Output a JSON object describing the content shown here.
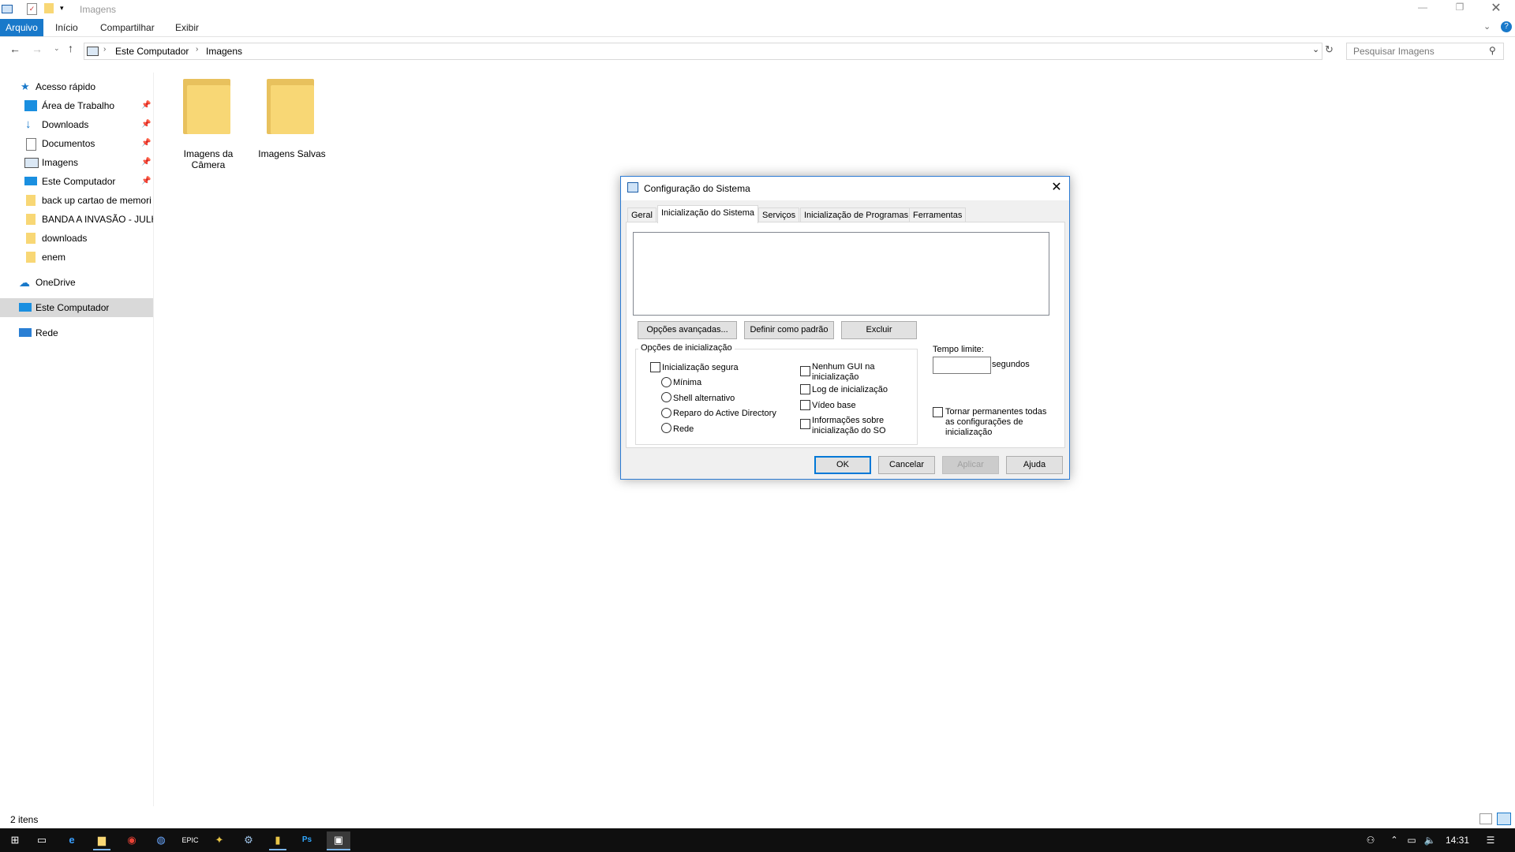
{
  "window": {
    "title": "Imagens",
    "ribbon_tabs": [
      "Arquivo",
      "Início",
      "Compartilhar",
      "Exibir"
    ]
  },
  "address": {
    "path": [
      "Este Computador",
      "Imagens"
    ],
    "search_placeholder": "Pesquisar Imagens"
  },
  "nav": {
    "quick_access": "Acesso rápido",
    "items": [
      {
        "label": "Área de Trabalho",
        "icon": "desktop-icon",
        "pinned": true
      },
      {
        "label": "Downloads",
        "icon": "download-arrow-icon",
        "pinned": true
      },
      {
        "label": "Documentos",
        "icon": "document-icon",
        "pinned": true
      },
      {
        "label": "Imagens",
        "icon": "pictures-icon",
        "pinned": true
      },
      {
        "label": "Este Computador",
        "icon": "computer-icon",
        "pinned": true
      },
      {
        "label": "back up cartao de memori",
        "icon": "folder-icon",
        "pinned": false
      },
      {
        "label": "BANDA A INVASÃO - JULH",
        "icon": "folder-icon",
        "pinned": false
      },
      {
        "label": "downloads",
        "icon": "folder-icon",
        "pinned": false
      },
      {
        "label": "enem",
        "icon": "folder-icon",
        "pinned": false
      }
    ],
    "onedrive": "OneDrive",
    "this_pc": "Este Computador",
    "network": "Rede"
  },
  "content": {
    "folders": [
      {
        "line1": "Imagens da",
        "line2": "Câmera"
      },
      {
        "line1": "Imagens Salvas",
        "line2": ""
      }
    ]
  },
  "status": {
    "item_count": "2 itens"
  },
  "taskbar": {
    "clock": "14:31"
  },
  "dialog": {
    "title": "Configuração do Sistema",
    "tabs": [
      "Geral",
      "Inicialização do Sistema",
      "Serviços",
      "Inicialização de Programas",
      "Ferramentas"
    ],
    "active_tab": "Inicialização do Sistema",
    "buttons": {
      "advanced": "Opções avançadas...",
      "set_default": "Definir como padrão",
      "delete": "Excluir",
      "ok": "OK",
      "cancel": "Cancelar",
      "apply": "Aplicar",
      "help": "Ajuda"
    },
    "boot_options_label": "Opções de inicialização",
    "safe_boot": "Inicialização segura",
    "radios": [
      "Mínima",
      "Shell alternativo",
      "Reparo do Active Directory",
      "Rede"
    ],
    "checks": {
      "no_gui_1": "Nenhum GUI na",
      "no_gui_2": "inicialização",
      "boot_log": "Log de inicialização",
      "base_video": "Vídeo base",
      "os_info_1": "Informações sobre",
      "os_info_2": "inicialização do SO"
    },
    "timeout_label": "Tempo limite:",
    "timeout_value": "",
    "timeout_unit": "segundos",
    "permanent_1": "Tornar permanentes todas",
    "permanent_2": "as configurações de",
    "permanent_3": "inicialização"
  }
}
